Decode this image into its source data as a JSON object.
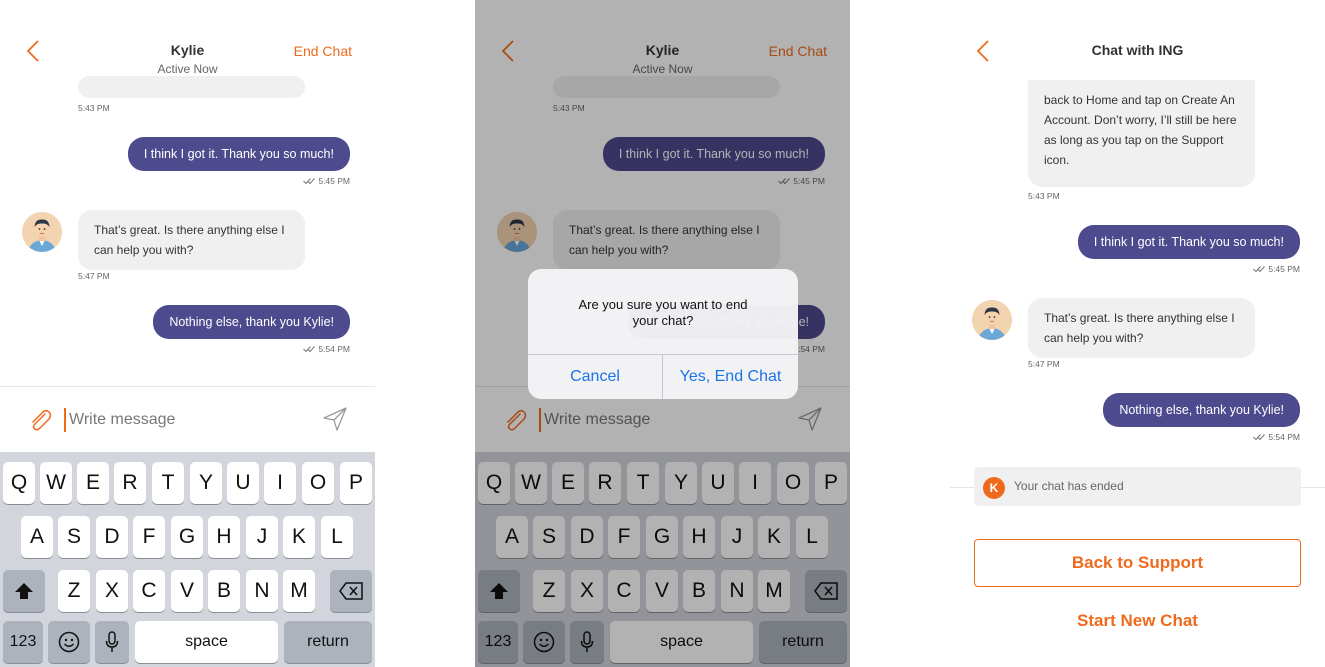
{
  "chat": {
    "agent_name": "Kylie",
    "status": "Active Now",
    "end_chat_label": "End Chat",
    "messages": [
      {
        "time": "5:43 PM"
      },
      {
        "text": "I think I got it. Thank you so much!",
        "time": "5:45 PM"
      },
      {
        "text": "That’s great. Is there anything else I can help you with?",
        "time": "5:47 PM"
      },
      {
        "text": "Nothing else, thank you Kylie!",
        "time": "5:54 PM"
      }
    ],
    "input_placeholder": "Write message"
  },
  "dialog": {
    "message": "Are you sure you want to end your chat?",
    "cancel_label": "Cancel",
    "confirm_label": "Yes, End Chat"
  },
  "ended_screen": {
    "title": "Chat with ING",
    "first_message": "back to Home and tap on Create An Account. Don’t worry, I’ll still be here as long as you tap on the Support icon.",
    "first_time": "5:43 PM",
    "ended_initial": "K",
    "ended_text": "Your chat has ended",
    "back_button": "Back to Support",
    "new_chat_button": "Start New Chat"
  },
  "keyboard": {
    "row1": [
      "Q",
      "W",
      "E",
      "R",
      "T",
      "Y",
      "U",
      "I",
      "O",
      "P"
    ],
    "row2": [
      "A",
      "S",
      "D",
      "F",
      "G",
      "H",
      "J",
      "K",
      "L"
    ],
    "row3": [
      "Z",
      "X",
      "C",
      "V",
      "B",
      "N",
      "M"
    ],
    "numbers_key": "123",
    "space_key": "space",
    "return_key": "return"
  },
  "colors": {
    "accent": "#f06a1d",
    "outgoing_bubble": "#4e4a8e",
    "incoming_bubble": "#f0f0f0",
    "dialog_button": "#1a73e8"
  }
}
